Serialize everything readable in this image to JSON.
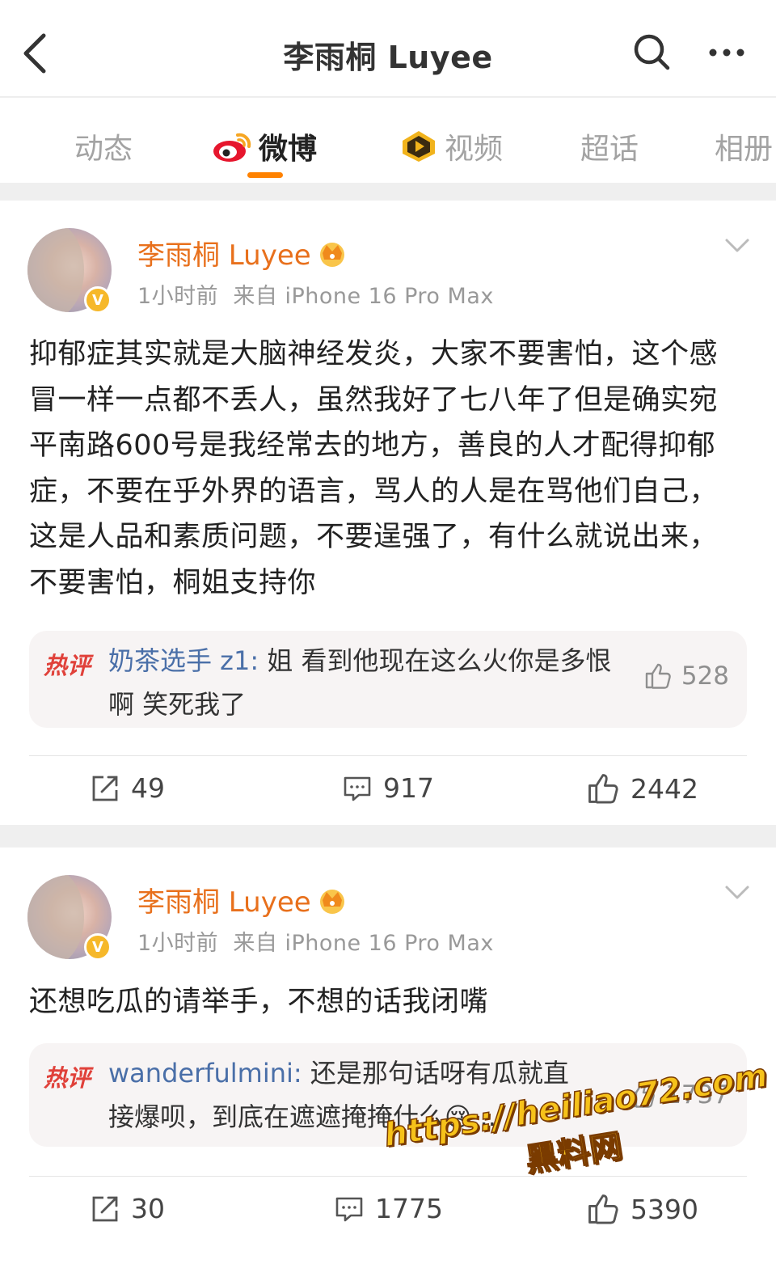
{
  "header": {
    "title": "李雨桐 Luyee"
  },
  "tabs": [
    {
      "label": "动态",
      "active": false
    },
    {
      "label": "微博",
      "active": true
    },
    {
      "label": "视频",
      "active": false
    },
    {
      "label": "超话",
      "active": false
    },
    {
      "label": "相册",
      "active": false
    }
  ],
  "posts": [
    {
      "author": "李雨桐 Luyee",
      "time": "1小时前",
      "source": "来自 iPhone 16 Pro Max",
      "content": "抑郁症其实就是大脑神经发炎，大家不要害怕，这个感冒一样一点都不丢人，虽然我好了七八年了但是确实宛平南路600号是我经常去的地方，善良的人才配得抑郁症，不要在乎外界的语言，骂人的人是在骂他们自己，这是人品和素质问题，不要逞强了，有什么就说出来，不要害怕，桐姐支持你",
      "hot_comment": {
        "tag": "热评",
        "user": "奶茶选手 z1:",
        "text": " 姐 看到他现在这么火你是多恨啊 笑死我了",
        "likes": "528"
      },
      "reposts": "49",
      "comments": "917",
      "likes": "2442"
    },
    {
      "author": "李雨桐 Luyee",
      "time": "1小时前",
      "source": "来自 iPhone 16 Pro Max",
      "content": "还想吃瓜的请举手，不想的话我闭嘴",
      "hot_comment": {
        "tag": "热评",
        "user": "wanderfulmini:",
        "text": " 还是那句话呀有瓜就直接爆呗，到底在遮遮掩掩什么😢...",
        "likes": "1737"
      },
      "reposts": "30",
      "comments": "1775",
      "likes": "5390"
    }
  ],
  "watermark": {
    "url": "https://heiliao72.com",
    "name": "黑料网"
  },
  "colors": {
    "accent": "#ff8200",
    "name": "#e8701c",
    "hot_tag": "#e0413a",
    "hot_user": "#4a6fa8"
  }
}
